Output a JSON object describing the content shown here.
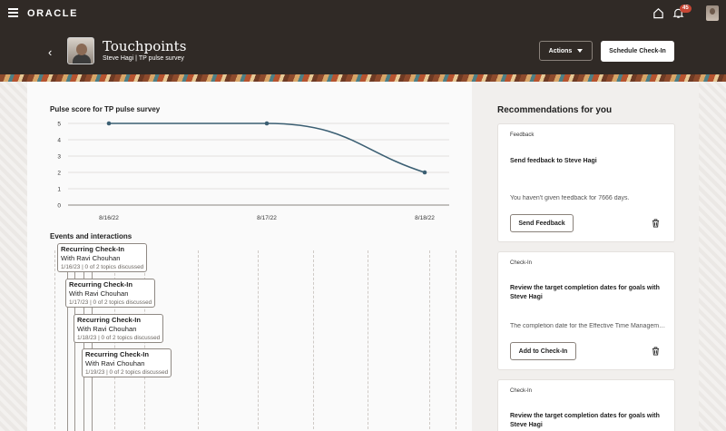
{
  "topbar": {
    "brand": "ORACLE",
    "notification_count": "45"
  },
  "header": {
    "title": "Touchpoints",
    "subtitle": "Steve Hagi | TP pulse survey",
    "actions_label": "Actions",
    "schedule_label": "Schedule Check-In"
  },
  "chart_data": {
    "type": "line",
    "title": "Pulse score for TP pulse survey",
    "categories": [
      "8/16/22",
      "8/17/22",
      "8/18/22"
    ],
    "series": [
      {
        "values": [
          5,
          5,
          2
        ]
      }
    ],
    "ylim": [
      0,
      5
    ],
    "yticks": [
      "0",
      "1",
      "2",
      "3",
      "4",
      "5"
    ],
    "grid": true,
    "color": "#3b5f73"
  },
  "events": {
    "title": "Events and interactions",
    "items": [
      {
        "title": "Recurring Check-In",
        "with": "With Ravi Chouhan",
        "meta": "1/16/23 | 0 of 2 topics discussed"
      },
      {
        "title": "Recurring Check-In",
        "with": "With Ravi Chouhan",
        "meta": "1/17/23 | 0 of 2 topics discussed"
      },
      {
        "title": "Recurring Check-In",
        "with": "With Ravi Chouhan",
        "meta": "1/18/23 | 0 of 2 topics discussed"
      },
      {
        "title": "Recurring Check-In",
        "with": "With Ravi Chouhan",
        "meta": "1/19/23 | 0 of 2 topics discussed"
      }
    ]
  },
  "recommendations": {
    "title": "Recommendations for you",
    "cards": [
      {
        "category": "Feedback",
        "title": "Send feedback to Steve Hagi",
        "description": "You haven't given feedback for 7666 days.",
        "button": "Send Feedback"
      },
      {
        "category": "Check-In",
        "title": "Review the target completion dates for goals with Steve Hagi",
        "description": "The completion date for the Effective Time Management goal is approaching.",
        "button": "Add to Check-In"
      },
      {
        "category": "Check-In",
        "title": "Review the target completion dates for goals with Steve Hagi"
      }
    ]
  }
}
